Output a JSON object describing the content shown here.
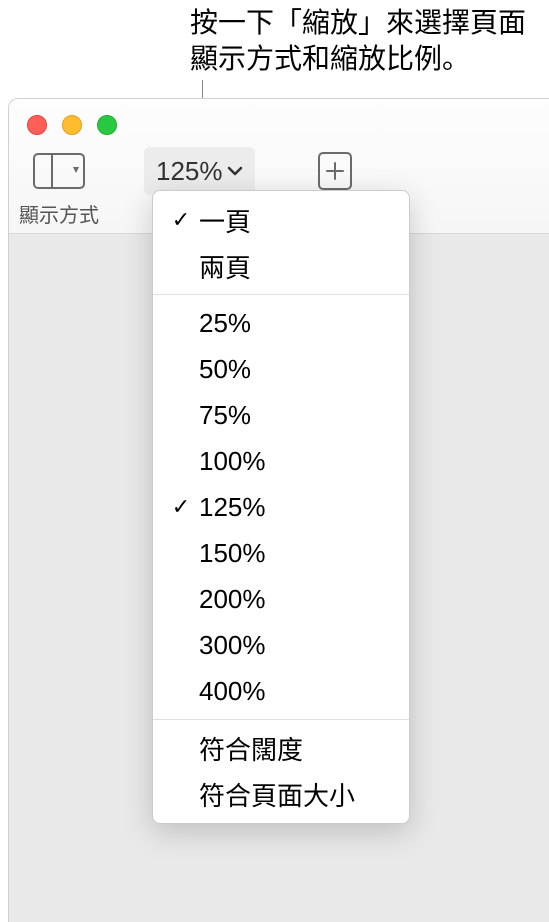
{
  "callout": {
    "text": "按一下「縮放」來選擇頁面\n顯示方式和縮放比例。"
  },
  "toolbar": {
    "view_label": "顯示方式",
    "zoom_value": "125%"
  },
  "dropdown": {
    "page_modes": [
      {
        "label": "一頁",
        "checked": true
      },
      {
        "label": "兩頁",
        "checked": false
      }
    ],
    "zoom_levels": [
      {
        "label": "25%",
        "checked": false
      },
      {
        "label": "50%",
        "checked": false
      },
      {
        "label": "75%",
        "checked": false
      },
      {
        "label": "100%",
        "checked": false
      },
      {
        "label": "125%",
        "checked": true
      },
      {
        "label": "150%",
        "checked": false
      },
      {
        "label": "200%",
        "checked": false
      },
      {
        "label": "300%",
        "checked": false
      },
      {
        "label": "400%",
        "checked": false
      }
    ],
    "fit_options": [
      {
        "label": "符合闊度",
        "checked": false
      },
      {
        "label": "符合頁面大小",
        "checked": false
      }
    ]
  }
}
